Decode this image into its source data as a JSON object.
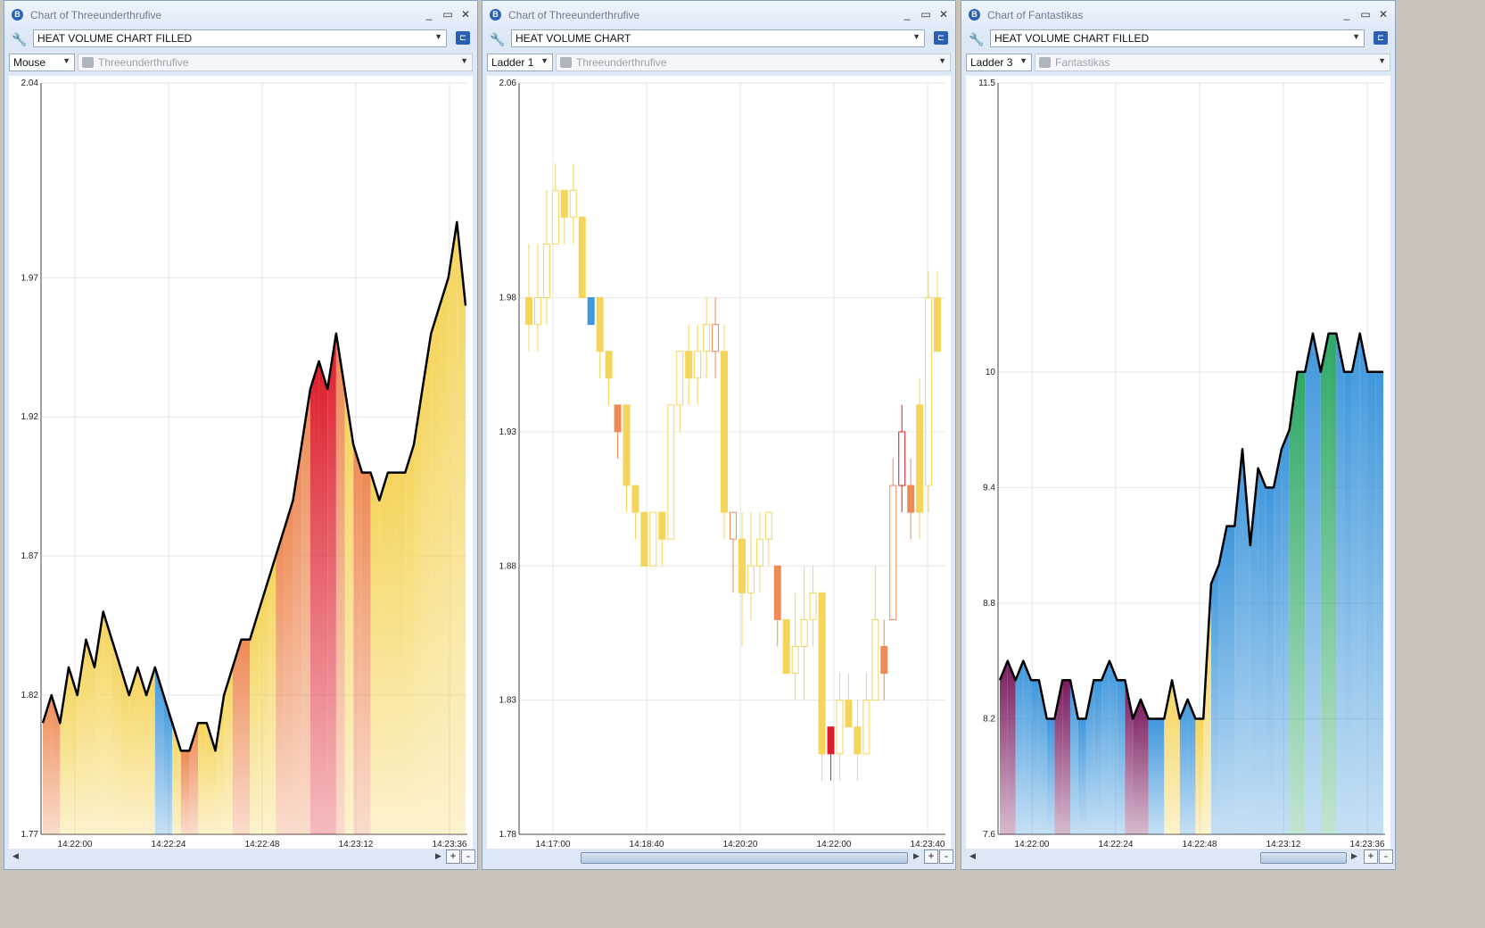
{
  "windows": [
    {
      "title": "Chart of Threeunderthrufive",
      "chart_type": "HEAT VOLUME CHART FILLED",
      "mode": "Mouse",
      "instrument": "Threeunderthrufive"
    },
    {
      "title": "Chart of Threeunderthrufive",
      "chart_type": "HEAT VOLUME CHART",
      "mode": "Ladder 1",
      "instrument": "Threeunderthrufive"
    },
    {
      "title": "Chart of Fantastikas",
      "chart_type": "HEAT VOLUME CHART FILLED",
      "mode": "Ladder 3",
      "instrument": "Fantastikas"
    }
  ],
  "controls": {
    "minimize": "_",
    "maximize": "▭",
    "close": "✕",
    "zoom_in": "+",
    "zoom_out": "-"
  },
  "colors": {
    "low_volume": "#f5d45a",
    "mid_volume": "#ee8a55",
    "high_volume": "#dc1f2c",
    "blue": "#3f97dc",
    "purple": "#7a1b5e",
    "green": "#2fa866"
  },
  "chart_data": [
    {
      "type": "area",
      "title": "HEAT VOLUME CHART FILLED",
      "x_ticks": [
        "14:22:00",
        "14:22:24",
        "14:22:48",
        "14:23:12",
        "14:23:36"
      ],
      "y_ticks": [
        "2.04",
        "1.97",
        "1.92",
        "1.87",
        "1.82",
        "1.77"
      ],
      "ylim": [
        1.77,
        2.04
      ],
      "grid": true,
      "x": [
        "14:21:56",
        "14:21:58",
        "14:22:00",
        "14:22:02",
        "14:22:04",
        "14:22:06",
        "14:22:08",
        "14:22:10",
        "14:22:12",
        "14:22:14",
        "14:22:16",
        "14:22:18",
        "14:22:20",
        "14:22:22",
        "14:22:24",
        "14:22:26",
        "14:22:28",
        "14:22:30",
        "14:22:32",
        "14:22:34",
        "14:22:36",
        "14:22:38",
        "14:22:40",
        "14:22:42",
        "14:22:44",
        "14:22:46",
        "14:22:48",
        "14:22:50",
        "14:22:52",
        "14:22:54",
        "14:22:56",
        "14:22:58",
        "14:23:00",
        "14:23:02",
        "14:23:04",
        "14:23:06",
        "14:23:08",
        "14:23:10",
        "14:23:12",
        "14:23:14",
        "14:23:16",
        "14:23:18",
        "14:23:20",
        "14:23:22",
        "14:23:24",
        "14:23:26",
        "14:23:28",
        "14:23:30",
        "14:23:32",
        "14:23:34",
        "14:23:36",
        "14:23:38",
        "14:23:40",
        "14:23:42",
        "14:23:44",
        "14:23:46",
        "14:23:48",
        "14:23:50",
        "14:23:52",
        "14:23:54"
      ],
      "values": [
        1.81,
        1.82,
        1.81,
        1.83,
        1.82,
        1.84,
        1.83,
        1.85,
        1.84,
        1.83,
        1.82,
        1.83,
        1.82,
        1.83,
        1.82,
        1.81,
        1.8,
        1.8,
        1.81,
        1.81,
        1.8,
        1.82,
        1.83,
        1.84,
        1.84,
        1.85,
        1.86,
        1.87,
        1.88,
        1.89,
        1.91,
        1.93,
        1.94,
        1.93,
        1.95,
        1.93,
        1.91,
        1.9,
        1.9,
        1.89,
        1.9,
        1.9,
        1.9,
        1.91,
        1.93,
        1.95,
        1.96,
        1.97,
        1.99,
        1.96
      ],
      "heat": [
        "mid",
        "mid",
        "low",
        "low",
        "low",
        "low",
        "low",
        "low",
        "low",
        "low",
        "low",
        "low",
        "low",
        "blue",
        "blue",
        "low",
        "mid",
        "mid",
        "low",
        "low",
        "low",
        "low",
        "mid",
        "mid",
        "low",
        "low",
        "low",
        "mid",
        "mid",
        "mid",
        "mid",
        "high",
        "high",
        "high",
        "mid",
        "low",
        "mid",
        "mid",
        "low",
        "low",
        "low",
        "low",
        "low",
        "low",
        "low",
        "low",
        "low",
        "low",
        "low",
        "low"
      ]
    },
    {
      "type": "candlestick",
      "title": "HEAT VOLUME CHART",
      "x_ticks": [
        "14:17:00",
        "14:18:40",
        "14:20:20",
        "14:22:00",
        "14:23:40"
      ],
      "y_ticks": [
        "2.06",
        "1.98",
        "1.93",
        "1.88",
        "1.83",
        "1.78"
      ],
      "ylim": [
        1.78,
        2.06
      ],
      "grid": true,
      "candles": [
        {
          "o": 1.98,
          "c": 1.97,
          "h": 2.0,
          "l": 1.96,
          "heat": "low"
        },
        {
          "o": 1.97,
          "c": 1.98,
          "h": 2.0,
          "l": 1.96,
          "heat": "low-hollow"
        },
        {
          "o": 1.98,
          "c": 2.0,
          "h": 2.02,
          "l": 1.97,
          "heat": "low-hollow"
        },
        {
          "o": 2.0,
          "c": 2.02,
          "h": 2.03,
          "l": 2.0,
          "heat": "low-hollow"
        },
        {
          "o": 2.02,
          "c": 2.01,
          "h": 2.02,
          "l": 2.0,
          "heat": "low"
        },
        {
          "o": 2.01,
          "c": 2.02,
          "h": 2.03,
          "l": 2.0,
          "heat": "low-hollow"
        },
        {
          "o": 2.01,
          "c": 1.98,
          "h": 2.01,
          "l": 1.98,
          "heat": "low"
        },
        {
          "o": 1.98,
          "c": 1.97,
          "h": 1.98,
          "l": 1.97,
          "heat": "blue"
        },
        {
          "o": 1.98,
          "c": 1.96,
          "h": 1.98,
          "l": 1.95,
          "heat": "low"
        },
        {
          "o": 1.96,
          "c": 1.95,
          "h": 1.96,
          "l": 1.94,
          "heat": "low"
        },
        {
          "o": 1.94,
          "c": 1.93,
          "h": 1.94,
          "l": 1.92,
          "heat": "mid"
        },
        {
          "o": 1.94,
          "c": 1.91,
          "h": 1.94,
          "l": 1.9,
          "heat": "low"
        },
        {
          "o": 1.91,
          "c": 1.9,
          "h": 1.91,
          "l": 1.89,
          "heat": "low"
        },
        {
          "o": 1.9,
          "c": 1.88,
          "h": 1.9,
          "l": 1.88,
          "heat": "low"
        },
        {
          "o": 1.88,
          "c": 1.9,
          "h": 1.9,
          "l": 1.88,
          "heat": "low-hollow"
        },
        {
          "o": 1.9,
          "c": 1.89,
          "h": 1.9,
          "l": 1.88,
          "heat": "low"
        },
        {
          "o": 1.89,
          "c": 1.94,
          "h": 1.94,
          "l": 1.89,
          "heat": "low-hollow"
        },
        {
          "o": 1.94,
          "c": 1.96,
          "h": 1.96,
          "l": 1.93,
          "heat": "low-hollow"
        },
        {
          "o": 1.96,
          "c": 1.95,
          "h": 1.97,
          "l": 1.94,
          "heat": "low"
        },
        {
          "o": 1.95,
          "c": 1.96,
          "h": 1.97,
          "l": 1.94,
          "heat": "low-hollow"
        },
        {
          "o": 1.96,
          "c": 1.97,
          "h": 1.98,
          "l": 1.95,
          "heat": "low-hollow"
        },
        {
          "o": 1.97,
          "c": 1.96,
          "h": 1.98,
          "l": 1.95,
          "heat": "mid-hollow"
        },
        {
          "o": 1.96,
          "c": 1.9,
          "h": 1.97,
          "l": 1.89,
          "heat": "low"
        },
        {
          "o": 1.89,
          "c": 1.9,
          "h": 1.9,
          "l": 1.87,
          "heat": "mid-hollow"
        },
        {
          "o": 1.89,
          "c": 1.87,
          "h": 1.9,
          "l": 1.85,
          "heat": "low"
        },
        {
          "o": 1.87,
          "c": 1.88,
          "h": 1.9,
          "l": 1.86,
          "heat": "low-hollow"
        },
        {
          "o": 1.88,
          "c": 1.89,
          "h": 1.9,
          "l": 1.87,
          "heat": "low-hollow"
        },
        {
          "o": 1.89,
          "c": 1.9,
          "h": 1.9,
          "l": 1.88,
          "heat": "low-hollow"
        },
        {
          "o": 1.88,
          "c": 1.86,
          "h": 1.88,
          "l": 1.85,
          "heat": "mid"
        },
        {
          "o": 1.86,
          "c": 1.84,
          "h": 1.86,
          "l": 1.84,
          "heat": "low"
        },
        {
          "o": 1.84,
          "c": 1.85,
          "h": 1.87,
          "l": 1.83,
          "heat": "low-hollow"
        },
        {
          "o": 1.85,
          "c": 1.86,
          "h": 1.88,
          "l": 1.83,
          "heat": "low-hollow"
        },
        {
          "o": 1.86,
          "c": 1.87,
          "h": 1.88,
          "l": 1.85,
          "heat": "low-hollow"
        },
        {
          "o": 1.87,
          "c": 1.81,
          "h": 1.87,
          "l": 1.8,
          "heat": "low"
        },
        {
          "o": 1.81,
          "c": 1.82,
          "h": 1.82,
          "l": 1.8,
          "heat": "high"
        },
        {
          "o": 1.81,
          "c": 1.83,
          "h": 1.84,
          "l": 1.8,
          "heat": "low-hollow"
        },
        {
          "o": 1.83,
          "c": 1.82,
          "h": 1.84,
          "l": 1.82,
          "heat": "low"
        },
        {
          "o": 1.82,
          "c": 1.81,
          "h": 1.83,
          "l": 1.8,
          "heat": "low"
        },
        {
          "o": 1.81,
          "c": 1.83,
          "h": 1.84,
          "l": 1.81,
          "heat": "low-hollow"
        },
        {
          "o": 1.83,
          "c": 1.86,
          "h": 1.88,
          "l": 1.83,
          "heat": "low-hollow"
        },
        {
          "o": 1.84,
          "c": 1.85,
          "h": 1.86,
          "l": 1.83,
          "heat": "mid"
        },
        {
          "o": 1.86,
          "c": 1.91,
          "h": 1.92,
          "l": 1.86,
          "heat": "mid-hollow"
        },
        {
          "o": 1.91,
          "c": 1.93,
          "h": 1.94,
          "l": 1.9,
          "heat": "high-hollow"
        },
        {
          "o": 1.91,
          "c": 1.9,
          "h": 1.92,
          "l": 1.89,
          "heat": "mid"
        },
        {
          "o": 1.9,
          "c": 1.94,
          "h": 1.95,
          "l": 1.89,
          "heat": "low"
        },
        {
          "o": 1.91,
          "c": 1.98,
          "h": 1.99,
          "l": 1.9,
          "heat": "low-hollow"
        },
        {
          "o": 1.98,
          "c": 1.96,
          "h": 1.99,
          "l": 1.96,
          "heat": "low"
        }
      ]
    },
    {
      "type": "area",
      "title": "HEAT VOLUME CHART FILLED",
      "x_ticks": [
        "14:22:00",
        "14:22:24",
        "14:22:48",
        "14:23:12",
        "14:23:36"
      ],
      "y_ticks": [
        "11.5",
        "10",
        "9.4",
        "8.8",
        "8.2",
        "7.6"
      ],
      "ylim": [
        7.6,
        11.5
      ],
      "grid": true,
      "x": [
        "14:21:56",
        "14:21:58",
        "14:22:00",
        "14:22:02",
        "14:22:04",
        "14:22:06",
        "14:22:08",
        "14:22:10",
        "14:22:12",
        "14:22:14",
        "14:22:16",
        "14:22:18",
        "14:22:20",
        "14:22:22",
        "14:22:24",
        "14:22:26",
        "14:22:28",
        "14:22:30",
        "14:22:32",
        "14:22:34",
        "14:22:36",
        "14:22:38",
        "14:22:40",
        "14:22:42",
        "14:22:44",
        "14:22:46",
        "14:22:48",
        "14:22:50",
        "14:22:52",
        "14:22:54",
        "14:22:56",
        "14:22:58",
        "14:23:00",
        "14:23:02",
        "14:23:04",
        "14:23:06",
        "14:23:08",
        "14:23:10",
        "14:23:12",
        "14:23:14",
        "14:23:16",
        "14:23:18",
        "14:23:20",
        "14:23:22",
        "14:23:24",
        "14:23:26",
        "14:23:28",
        "14:23:30",
        "14:23:32",
        "14:23:34",
        "14:23:36",
        "14:23:38",
        "14:23:40",
        "14:23:42",
        "14:23:44",
        "14:23:46",
        "14:23:48",
        "14:23:50",
        "14:23:52",
        "14:23:54"
      ],
      "values": [
        8.4,
        8.5,
        8.4,
        8.5,
        8.4,
        8.4,
        8.2,
        8.2,
        8.4,
        8.4,
        8.2,
        8.2,
        8.4,
        8.4,
        8.5,
        8.4,
        8.4,
        8.2,
        8.3,
        8.2,
        8.2,
        8.2,
        8.4,
        8.2,
        8.3,
        8.2,
        8.2,
        8.9,
        9.0,
        9.2,
        9.2,
        9.6,
        9.1,
        9.5,
        9.4,
        9.4,
        9.6,
        9.7,
        10.0,
        10.0,
        10.2,
        10.0,
        10.2,
        10.2,
        10.0,
        10.0,
        10.2,
        10.0,
        10.0,
        10.0
      ],
      "heat": [
        "purple",
        "purple",
        "blue",
        "blue",
        "blue",
        "blue",
        "blue",
        "purple",
        "purple",
        "blue",
        "blue",
        "blue",
        "blue",
        "blue",
        "blue",
        "blue",
        "purple",
        "purple",
        "purple",
        "blue",
        "blue",
        "low",
        "low",
        "blue",
        "blue",
        "low",
        "low",
        "blue",
        "blue",
        "blue",
        "blue",
        "blue",
        "blue",
        "blue",
        "blue",
        "blue",
        "blue",
        "green",
        "green",
        "blue",
        "blue",
        "green",
        "green",
        "blue",
        "blue",
        "blue",
        "blue",
        "blue",
        "blue",
        "blue"
      ]
    }
  ]
}
